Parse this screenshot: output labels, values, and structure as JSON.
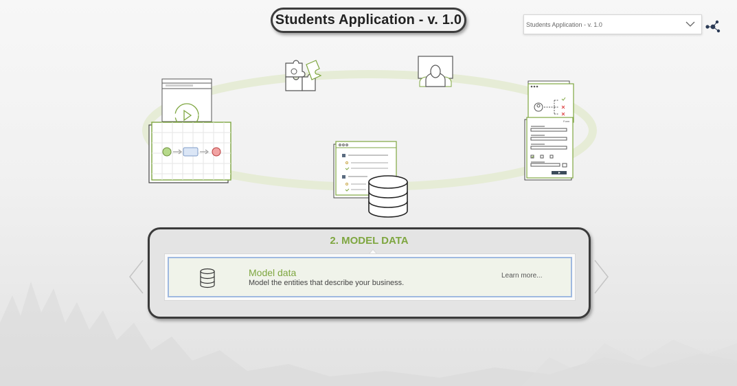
{
  "header": {
    "title": "Students Application - v. 1.0"
  },
  "app_selector": {
    "selected": "Students Application - v. 1.0",
    "icon": "chevron-down-icon"
  },
  "menu": {
    "icon": "dots-network-icon"
  },
  "stages": [
    {
      "id": "design-process",
      "icon": "process-flow-icon"
    },
    {
      "id": "integrate",
      "icon": "puzzle-icon"
    },
    {
      "id": "users",
      "icon": "user-group-icon"
    },
    {
      "id": "forms",
      "icon": "form-icon",
      "form_label": "Form"
    },
    {
      "id": "model-data",
      "icon": "database-icon"
    }
  ],
  "step": {
    "title": "2. MODEL DATA",
    "card": {
      "icon": "database-icon",
      "title": "Model data",
      "description": "Model the entities that describe your business.",
      "link": "Learn more..."
    }
  },
  "colors": {
    "accent_green": "#7ea640",
    "ring": "#e6ecd6",
    "panel_border": "#3b3b3b",
    "card_border": "#9fb9e0"
  }
}
